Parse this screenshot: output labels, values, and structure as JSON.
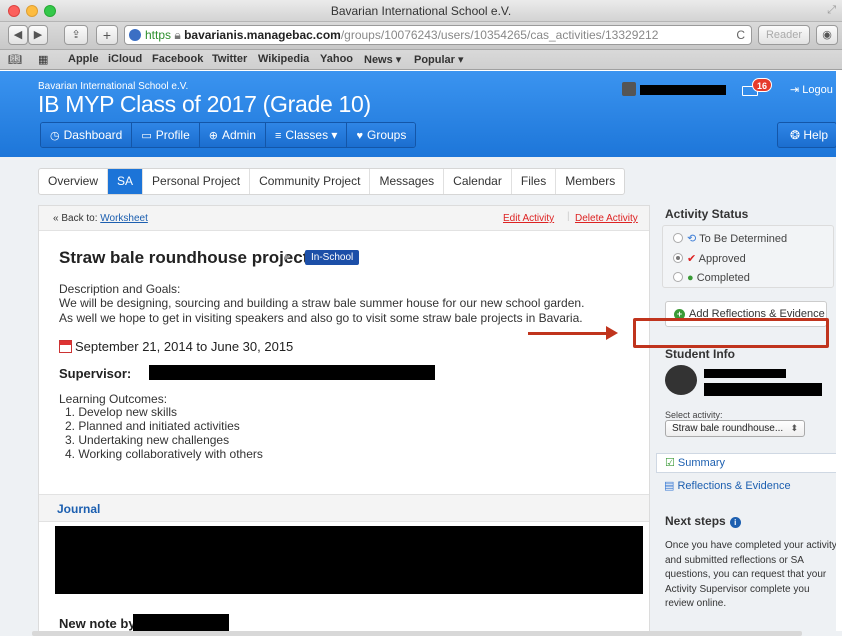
{
  "window": {
    "title": "Bavarian International School e.V."
  },
  "toolbar": {
    "back": "◀",
    "forward": "▶",
    "share": "⇪",
    "add": "+",
    "url_scheme": "https",
    "url_host": "bavarianis.managebac.com",
    "url_path": "/groups/10076243/users/10354265/cas_activities/13329212",
    "reload": "C",
    "reader": "Reader"
  },
  "bookmarks": {
    "items": [
      "Apple",
      "iCloud",
      "Facebook",
      "Twitter",
      "Wikipedia",
      "Yahoo",
      "News ▾",
      "Popular ▾"
    ]
  },
  "header": {
    "school": "Bavarian International School e.V.",
    "class_name": "IB MYP Class of 2017 (Grade 10)",
    "notification_count": "16",
    "logout": "Logou"
  },
  "nav": {
    "items": [
      {
        "icon": "◷",
        "label": "Dashboard"
      },
      {
        "icon": "▭",
        "label": "Profile"
      },
      {
        "icon": "⊕",
        "label": "Admin"
      },
      {
        "icon": "≡",
        "label": "Classes ▾"
      },
      {
        "icon": "♥",
        "label": "Groups"
      }
    ],
    "help": "Help"
  },
  "tabs": [
    "Overview",
    "SA",
    "Personal Project",
    "Community Project",
    "Messages",
    "Calendar",
    "Files",
    "Members"
  ],
  "activity": {
    "back_prefix": "« Back to:",
    "back_link": "Worksheet",
    "edit": "Edit Activity",
    "delete": "Delete Activity",
    "title": "Straw bale roundhouse project",
    "tag": "In-School",
    "desc_label": "Description and Goals:",
    "desc_line1": "We will be designing, sourcing and building a straw bale summer house for our new school garden.",
    "desc_line2": "As well we hope to get in visiting speakers and also go to visit some straw bale projects in Bavaria.",
    "dates": "September 21, 2014 to June 30, 2015",
    "supervisor_label": "Supervisor:",
    "outcomes_label": "Learning Outcomes:",
    "outcomes": [
      "1. Develop new skills",
      "2. Planned and initiated activities",
      "3. Undertaking new challenges",
      "4. Working collaboratively with others"
    ],
    "journal": "Journal",
    "new_note": "New note by"
  },
  "side": {
    "status_title": "Activity Status",
    "statuses": [
      "To Be Determined",
      "Approved",
      "Completed"
    ],
    "add_btn": "Add Reflections & Evidence",
    "student_info": "Student Info",
    "select_label": "Select activity:",
    "select_value": "Straw bale roundhouse...",
    "summary": "Summary",
    "reflections": "Reflections & Evidence",
    "next_title": "Next steps",
    "next_text": "Once you have completed your activity and submitted reflections or SA questions, you can request that your Activity Supervisor complete you review online."
  },
  "colors": {
    "header_blue": "#1d76d9",
    "active_tab": "#1c74d8",
    "highlight_red": "#c0341d",
    "link": "#1c5fb0"
  }
}
